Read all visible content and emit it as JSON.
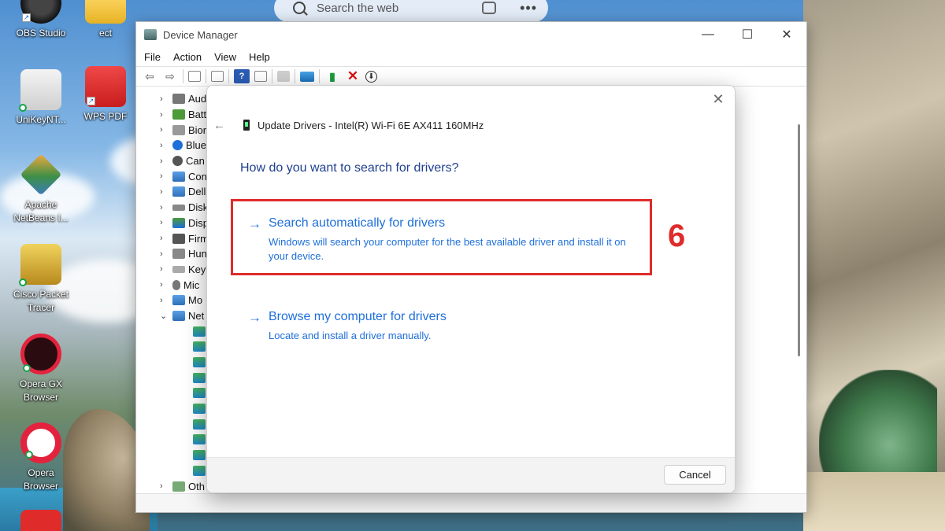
{
  "top_search": {
    "placeholder": "Search the web",
    "more_label": "•••"
  },
  "desktop_icons": [
    {
      "label": "OBS Studio"
    },
    {
      "label": "ect"
    },
    {
      "label": "UniKeyNT..."
    },
    {
      "label": "WPS PDF"
    },
    {
      "label": "Apache NetBeans I..."
    },
    {
      "label": "Cisco Packet Tracer"
    },
    {
      "label": "Opera GX Browser"
    },
    {
      "label": "Opera Browser"
    }
  ],
  "device_manager": {
    "title": "Device Manager",
    "window_controls": {
      "minimize": "—",
      "maximize": "☐",
      "close": "✕"
    },
    "menu": [
      "File",
      "Action",
      "View",
      "Help"
    ],
    "tree": [
      {
        "label": "Aud",
        "chevron": "›"
      },
      {
        "label": "Batt",
        "chevron": "›"
      },
      {
        "label": "Bior",
        "chevron": "›"
      },
      {
        "label": "Blue",
        "chevron": "›"
      },
      {
        "label": "Can",
        "chevron": "›"
      },
      {
        "label": "Con",
        "chevron": "›"
      },
      {
        "label": "Dell",
        "chevron": "›"
      },
      {
        "label": "Disk",
        "chevron": "›"
      },
      {
        "label": "Disp",
        "chevron": "›"
      },
      {
        "label": "Firm",
        "chevron": "›"
      },
      {
        "label": "Hun",
        "chevron": "›"
      },
      {
        "label": "Key",
        "chevron": "›"
      },
      {
        "label": "Mic",
        "chevron": "›"
      },
      {
        "label": "Mo",
        "chevron": "›"
      },
      {
        "label": "Net",
        "chevron": "⌄"
      }
    ],
    "network_children_count": 10,
    "tree_last": {
      "label": "Oth",
      "chevron": "›"
    }
  },
  "dialog": {
    "close_label": "✕",
    "back_label": "←",
    "header": "Update Drivers - Intel(R) Wi-Fi 6E AX411 160MHz",
    "question": "How do you want to search for drivers?",
    "options": [
      {
        "arrow": "→",
        "title": "Search automatically for drivers",
        "description": "Windows will search your computer for the best available driver and install it on your device."
      },
      {
        "arrow": "→",
        "title": "Browse my computer for drivers",
        "description": "Locate and install a driver manually."
      }
    ],
    "cancel_label": "Cancel"
  },
  "annotation": {
    "step_number": "6",
    "color": "#e02b2b"
  },
  "colors": {
    "link_blue": "#1e6fd9",
    "question_blue": "#1f3f8f"
  }
}
